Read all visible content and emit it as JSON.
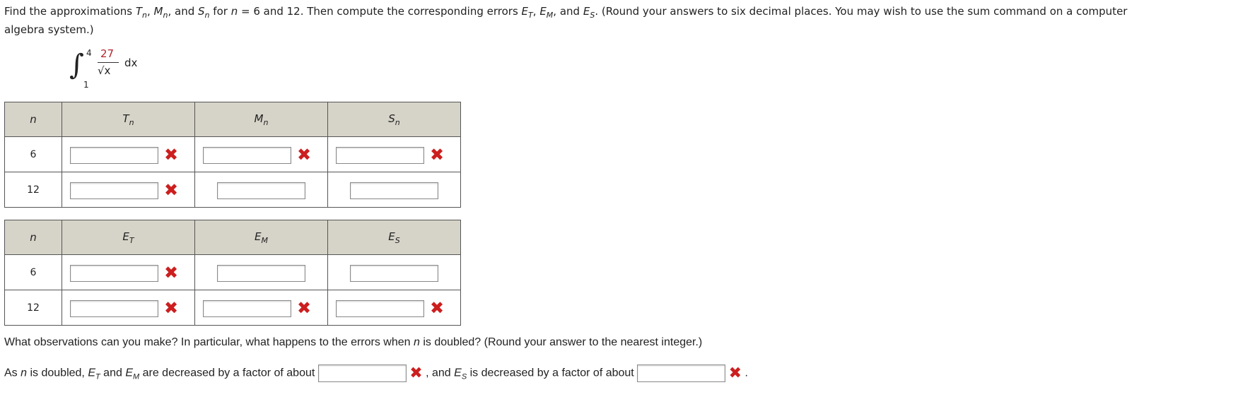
{
  "prompt": {
    "line1_a": "Find the approximations ",
    "T": "T",
    "M": "M",
    "S": "S",
    "n": "n",
    "sep": ", ",
    "and": ", and ",
    "line1_b": " for ",
    "line1_c": " = 6 and 12. Then compute the corresponding errors ",
    "E": "E",
    "line1_d": " and ",
    "line1_e": ". (Round your answers to six decimal places. You may wish to use the sum command on a computer",
    "line2": "algebra system.)"
  },
  "integral": {
    "upper": "4",
    "lower": "1",
    "numerator": "27",
    "denominator": "√x",
    "dx": "dx"
  },
  "table1": {
    "headers": [
      "n",
      "T",
      "M",
      "S"
    ],
    "header_sub": "n",
    "rows": [
      {
        "n": "6",
        "marks": [
          "✖",
          "✖",
          "✖"
        ]
      },
      {
        "n": "12",
        "marks": [
          "✖",
          "",
          ""
        ]
      }
    ]
  },
  "table2": {
    "headers": [
      "n",
      "E",
      "E",
      "E"
    ],
    "header_subs": [
      "",
      "T",
      "M",
      "S"
    ],
    "rows": [
      {
        "n": "6",
        "marks": [
          "✖",
          "",
          ""
        ]
      },
      {
        "n": "12",
        "marks": [
          "✖",
          "✖",
          "✖"
        ]
      }
    ]
  },
  "observation": {
    "question_a": "What observations can you make? In particular, what happens to the errors when ",
    "n": "n",
    "question_b": " is doubled? (Round your answer to the nearest integer.)",
    "ans_a": "As ",
    "ans_b": " is doubled, ",
    "E": "E",
    "T": "T",
    "M": "M",
    "S": "S",
    "ans_and": " and ",
    "ans_c": " are decreased by a factor of about ",
    "ans_d": " , and ",
    "ans_e": " is decreased by a factor of about ",
    "ans_f": " .",
    "mark": "✖"
  },
  "colors": {
    "error_red": "#cc1f1f",
    "header_bg": "#d6d3c8",
    "fraction_red": "#b1252c"
  }
}
